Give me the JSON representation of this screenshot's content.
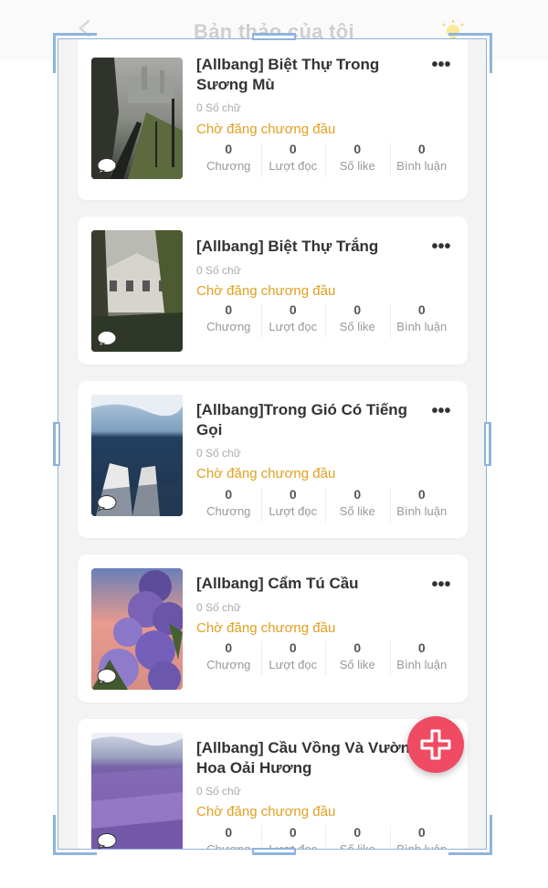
{
  "header": {
    "title": "Bản thảo của tôi"
  },
  "stat_labels": [
    "Chương",
    "Lượt đọc",
    "Số like",
    "Bình luận"
  ],
  "stories": [
    {
      "title": "[Allbang] Biệt Thự Trong Sương Mù",
      "word_count": "0 Số chữ",
      "status": "Chờ đăng chương đầu",
      "stats": [
        "0",
        "0",
        "0",
        "0"
      ]
    },
    {
      "title": "[Allbang] Biệt Thự Trắng",
      "word_count": "0 Số chữ",
      "status": "Chờ đăng chương đầu",
      "stats": [
        "0",
        "0",
        "0",
        "0"
      ]
    },
    {
      "title": "[Allbang]Trong Gió Có Tiếng Gọi",
      "word_count": "0 Số chữ",
      "status": "Chờ đăng chương đầu",
      "stats": [
        "0",
        "0",
        "0",
        "0"
      ]
    },
    {
      "title": "[Allbang] Cẩm Tú Cầu",
      "word_count": "0 Số chữ",
      "status": "Chờ đăng chương đầu",
      "stats": [
        "0",
        "0",
        "0",
        "0"
      ]
    },
    {
      "title": "[Allbang] Cầu Vồng Và Vườn Hoa Oải Hương",
      "word_count": "0 Số chữ",
      "status": "Chờ đăng chương đầu",
      "stats": [
        "0",
        "0",
        "0",
        "0"
      ]
    }
  ],
  "more_label": "•••",
  "colors": {
    "accent": "#ef4b63",
    "status": "#e0a020",
    "frame": "#8fb4de"
  },
  "icons": {
    "back": "chevron-left-icon",
    "bulb": "lightbulb-icon",
    "more": "more-icon",
    "chat": "chat-bubble-icon",
    "add": "plus-icon"
  }
}
